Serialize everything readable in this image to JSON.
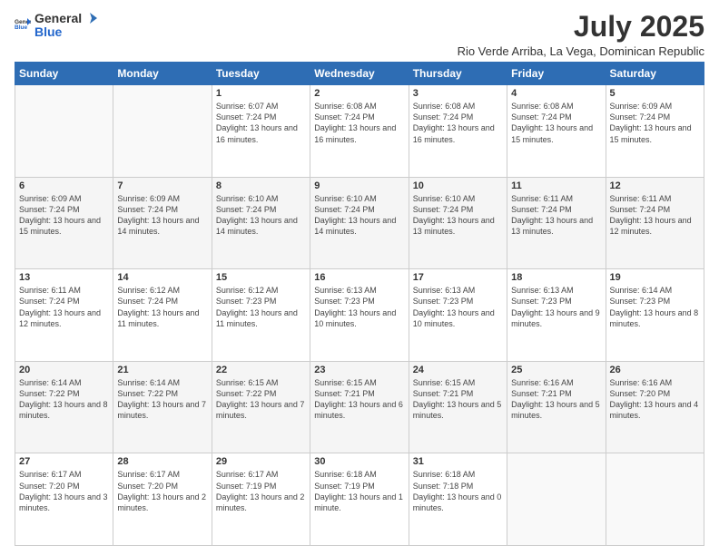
{
  "logo": {
    "general": "General",
    "blue": "Blue"
  },
  "header": {
    "title": "July 2025",
    "subtitle": "Rio Verde Arriba, La Vega, Dominican Republic"
  },
  "weekdays": [
    "Sunday",
    "Monday",
    "Tuesday",
    "Wednesday",
    "Thursday",
    "Friday",
    "Saturday"
  ],
  "weeks": [
    [
      {
        "day": "",
        "info": ""
      },
      {
        "day": "",
        "info": ""
      },
      {
        "day": "1",
        "info": "Sunrise: 6:07 AM\nSunset: 7:24 PM\nDaylight: 13 hours\nand 16 minutes."
      },
      {
        "day": "2",
        "info": "Sunrise: 6:08 AM\nSunset: 7:24 PM\nDaylight: 13 hours\nand 16 minutes."
      },
      {
        "day": "3",
        "info": "Sunrise: 6:08 AM\nSunset: 7:24 PM\nDaylight: 13 hours\nand 16 minutes."
      },
      {
        "day": "4",
        "info": "Sunrise: 6:08 AM\nSunset: 7:24 PM\nDaylight: 13 hours\nand 15 minutes."
      },
      {
        "day": "5",
        "info": "Sunrise: 6:09 AM\nSunset: 7:24 PM\nDaylight: 13 hours\nand 15 minutes."
      }
    ],
    [
      {
        "day": "6",
        "info": "Sunrise: 6:09 AM\nSunset: 7:24 PM\nDaylight: 13 hours\nand 15 minutes."
      },
      {
        "day": "7",
        "info": "Sunrise: 6:09 AM\nSunset: 7:24 PM\nDaylight: 13 hours\nand 14 minutes."
      },
      {
        "day": "8",
        "info": "Sunrise: 6:10 AM\nSunset: 7:24 PM\nDaylight: 13 hours\nand 14 minutes."
      },
      {
        "day": "9",
        "info": "Sunrise: 6:10 AM\nSunset: 7:24 PM\nDaylight: 13 hours\nand 14 minutes."
      },
      {
        "day": "10",
        "info": "Sunrise: 6:10 AM\nSunset: 7:24 PM\nDaylight: 13 hours\nand 13 minutes."
      },
      {
        "day": "11",
        "info": "Sunrise: 6:11 AM\nSunset: 7:24 PM\nDaylight: 13 hours\nand 13 minutes."
      },
      {
        "day": "12",
        "info": "Sunrise: 6:11 AM\nSunset: 7:24 PM\nDaylight: 13 hours\nand 12 minutes."
      }
    ],
    [
      {
        "day": "13",
        "info": "Sunrise: 6:11 AM\nSunset: 7:24 PM\nDaylight: 13 hours\nand 12 minutes."
      },
      {
        "day": "14",
        "info": "Sunrise: 6:12 AM\nSunset: 7:24 PM\nDaylight: 13 hours\nand 11 minutes."
      },
      {
        "day": "15",
        "info": "Sunrise: 6:12 AM\nSunset: 7:23 PM\nDaylight: 13 hours\nand 11 minutes."
      },
      {
        "day": "16",
        "info": "Sunrise: 6:13 AM\nSunset: 7:23 PM\nDaylight: 13 hours\nand 10 minutes."
      },
      {
        "day": "17",
        "info": "Sunrise: 6:13 AM\nSunset: 7:23 PM\nDaylight: 13 hours\nand 10 minutes."
      },
      {
        "day": "18",
        "info": "Sunrise: 6:13 AM\nSunset: 7:23 PM\nDaylight: 13 hours\nand 9 minutes."
      },
      {
        "day": "19",
        "info": "Sunrise: 6:14 AM\nSunset: 7:23 PM\nDaylight: 13 hours\nand 8 minutes."
      }
    ],
    [
      {
        "day": "20",
        "info": "Sunrise: 6:14 AM\nSunset: 7:22 PM\nDaylight: 13 hours\nand 8 minutes."
      },
      {
        "day": "21",
        "info": "Sunrise: 6:14 AM\nSunset: 7:22 PM\nDaylight: 13 hours\nand 7 minutes."
      },
      {
        "day": "22",
        "info": "Sunrise: 6:15 AM\nSunset: 7:22 PM\nDaylight: 13 hours\nand 7 minutes."
      },
      {
        "day": "23",
        "info": "Sunrise: 6:15 AM\nSunset: 7:21 PM\nDaylight: 13 hours\nand 6 minutes."
      },
      {
        "day": "24",
        "info": "Sunrise: 6:15 AM\nSunset: 7:21 PM\nDaylight: 13 hours\nand 5 minutes."
      },
      {
        "day": "25",
        "info": "Sunrise: 6:16 AM\nSunset: 7:21 PM\nDaylight: 13 hours\nand 5 minutes."
      },
      {
        "day": "26",
        "info": "Sunrise: 6:16 AM\nSunset: 7:20 PM\nDaylight: 13 hours\nand 4 minutes."
      }
    ],
    [
      {
        "day": "27",
        "info": "Sunrise: 6:17 AM\nSunset: 7:20 PM\nDaylight: 13 hours\nand 3 minutes."
      },
      {
        "day": "28",
        "info": "Sunrise: 6:17 AM\nSunset: 7:20 PM\nDaylight: 13 hours\nand 2 minutes."
      },
      {
        "day": "29",
        "info": "Sunrise: 6:17 AM\nSunset: 7:19 PM\nDaylight: 13 hours\nand 2 minutes."
      },
      {
        "day": "30",
        "info": "Sunrise: 6:18 AM\nSunset: 7:19 PM\nDaylight: 13 hours\nand 1 minute."
      },
      {
        "day": "31",
        "info": "Sunrise: 6:18 AM\nSunset: 7:18 PM\nDaylight: 13 hours\nand 0 minutes."
      },
      {
        "day": "",
        "info": ""
      },
      {
        "day": "",
        "info": ""
      }
    ]
  ]
}
